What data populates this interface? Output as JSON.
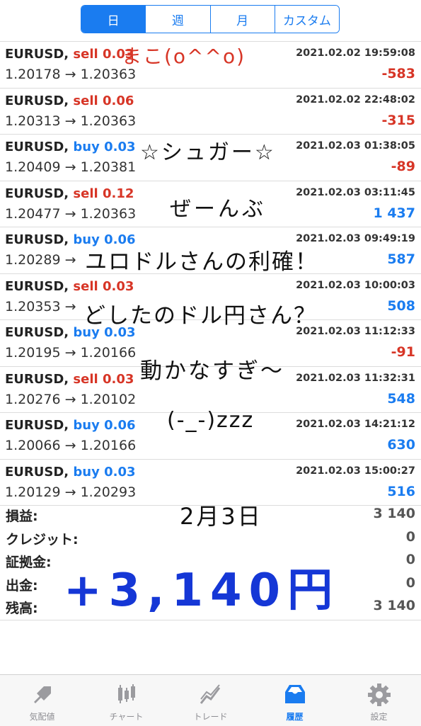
{
  "segments": [
    "日",
    "週",
    "月",
    "カスタム"
  ],
  "trades": [
    {
      "symbol": "EURUSD,",
      "side": "sell",
      "side_class": "sell",
      "lot": "0.03",
      "time": "2021.02.02 19:59:08",
      "open": "1.20178",
      "close": "1.20363",
      "arrow": "→",
      "profit": "-583",
      "profit_class": "neg"
    },
    {
      "symbol": "EURUSD,",
      "side": "sell",
      "side_class": "sell",
      "lot": "0.06",
      "time": "2021.02.02 22:48:02",
      "open": "1.20313",
      "close": "1.20363",
      "arrow": "→",
      "profit": "-315",
      "profit_class": "neg"
    },
    {
      "symbol": "EURUSD,",
      "side": "buy",
      "side_class": "buy",
      "lot": "0.03",
      "time": "2021.02.03 01:38:05",
      "open": "1.20409",
      "close": "1.20381",
      "arrow": "→",
      "profit": "-89",
      "profit_class": "neg"
    },
    {
      "symbol": "EURUSD,",
      "side": "sell",
      "side_class": "sell",
      "lot": "0.12",
      "time": "2021.02.03 03:11:45",
      "open": "1.20477",
      "close": "1.20363",
      "arrow": "→",
      "profit": "1 437",
      "profit_class": "pos"
    },
    {
      "symbol": "EURUSD,",
      "side": "buy",
      "side_class": "buy",
      "lot": "0.06",
      "time": "2021.02.03 09:49:19",
      "open": "1.20289",
      "close": "",
      "arrow": "→",
      "profit": "587",
      "profit_class": "pos"
    },
    {
      "symbol": "EURUSD,",
      "side": "sell",
      "side_class": "sell",
      "lot": "0.03",
      "time": "2021.02.03 10:00:03",
      "open": "1.20353",
      "close": "",
      "arrow": "→",
      "profit": "508",
      "profit_class": "pos"
    },
    {
      "symbol": "EURUSD,",
      "side": "buy",
      "side_class": "buy",
      "lot": "0.03",
      "time": "2021.02.03 11:12:33",
      "open": "1.20195",
      "close": "1.20166",
      "arrow": "→",
      "profit": "-91",
      "profit_class": "neg"
    },
    {
      "symbol": "EURUSD,",
      "side": "sell",
      "side_class": "sell",
      "lot": "0.03",
      "time": "2021.02.03 11:32:31",
      "open": "1.20276",
      "close": "1.20102",
      "arrow": "→",
      "profit": "548",
      "profit_class": "pos"
    },
    {
      "symbol": "EURUSD,",
      "side": "buy",
      "side_class": "buy",
      "lot": "0.06",
      "time": "2021.02.03 14:21:12",
      "open": "1.20066",
      "close": "1.20166",
      "arrow": "→",
      "profit": "630",
      "profit_class": "pos"
    },
    {
      "symbol": "EURUSD,",
      "side": "buy",
      "side_class": "buy",
      "lot": "0.03",
      "time": "2021.02.03 15:00:27",
      "open": "1.20129",
      "close": "1.20293",
      "arrow": "→",
      "profit": "516",
      "profit_class": "pos"
    }
  ],
  "summary": [
    {
      "label": "損益:",
      "value": "3 140"
    },
    {
      "label": "クレジット:",
      "value": "0"
    },
    {
      "label": "証拠金:",
      "value": "0"
    },
    {
      "label": "出金:",
      "value": "0"
    },
    {
      "label": "残高:",
      "value": "3 140"
    }
  ],
  "handwriting": {
    "name": "まこ(o^^o)",
    "line1": "☆シュガー☆",
    "line2": "ぜーんぶ",
    "line3": "ユロドルさんの利確！",
    "line4": "どしたのドル円さん？",
    "line5": "動かなすぎ〜",
    "line6": "(-_-)zzz",
    "date": "2月3日",
    "total": "+3,140円"
  },
  "tabs": [
    {
      "label": "気配値",
      "icon": "quotes-icon"
    },
    {
      "label": "チャート",
      "icon": "chart-icon"
    },
    {
      "label": "トレード",
      "icon": "trade-icon"
    },
    {
      "label": "履歴",
      "icon": "history-icon"
    },
    {
      "label": "設定",
      "icon": "settings-icon"
    }
  ],
  "colors": {
    "accent": "#1a7cf0",
    "sell": "#d73526",
    "handwriting_blue": "#1537d6"
  }
}
